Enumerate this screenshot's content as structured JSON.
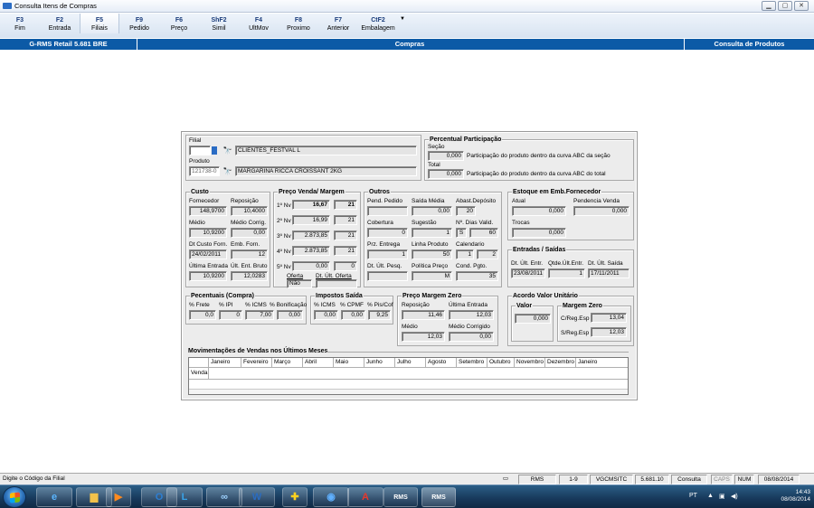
{
  "window": {
    "title": "Consulta Itens de Compras"
  },
  "fkeys": [
    {
      "key": "F3",
      "label": "Fim"
    },
    {
      "key": "F2",
      "label": "Entrada"
    },
    {
      "key": "F5",
      "label": "Filiais"
    },
    {
      "key": "F9",
      "label": "Pedido"
    },
    {
      "key": "F6",
      "label": "Preço"
    },
    {
      "key": "ShF2",
      "label": "Simil"
    },
    {
      "key": "F4",
      "label": "UltMov"
    },
    {
      "key": "F8",
      "label": "Proximo"
    },
    {
      "key": "F7",
      "label": "Anterior"
    },
    {
      "key": "CtF2",
      "label": "Embalagem"
    }
  ],
  "bluebar": {
    "left": "G-RMS Retail 5.681 BRE",
    "center": "Compras",
    "right": "Consulta de Produtos"
  },
  "filial": {
    "label": "Filial",
    "code": "",
    "name": "CLIENTES_FESTVAL L"
  },
  "produto": {
    "label": "Produto",
    "code": "121738-0",
    "name": "MARGARINA RICCA CROISSANT 2KG"
  },
  "percentual": {
    "title": "Percentual Participação",
    "secao_label": "Seção",
    "secao_value": "0,000",
    "secao_text": "Participação do produto dentro da curva ABC da seção",
    "total_label": "Total",
    "total_value": "0,000",
    "total_text": "Participação do produto dentro da curva ABC do total"
  },
  "custo": {
    "title": "Custo",
    "fornecedor_label": "Fornecedor",
    "fornecedor": "148,9700",
    "reposicao_label": "Reposição",
    "reposicao": "10,4000",
    "medio_label": "Médio",
    "medio": "10,9200",
    "medio_corrig_label": "Médio Corrig.",
    "medio_corrig": "0,00",
    "dt_custo_label": "Dt Custo Forn.",
    "dt_custo": "24/02/2011",
    "emb_forn_label": "Emb. Forn.",
    "emb_forn": "12",
    "ult_entrada_label": "Última Entrada",
    "ult_entrada": "10,9200",
    "ult_ent_bruto_label": "Últ. Ent. Bruto",
    "ult_ent_bruto": "12,0283"
  },
  "preco_venda": {
    "title": "Preço Venda/ Margem",
    "levels": [
      {
        "label": "1º Nv",
        "price": "16,67",
        "margin": "21"
      },
      {
        "label": "2º Nv",
        "price": "16,99",
        "margin": "21"
      },
      {
        "label": "3º Nv",
        "price": "2.873,85",
        "margin": "21"
      },
      {
        "label": "4º Nv",
        "price": "2.873,85",
        "margin": "21"
      },
      {
        "label": "5º Nv",
        "price": "0,00",
        "margin": "0"
      }
    ],
    "oferta_label": "Oferta",
    "oferta": "Não",
    "dt_ult_oferta_label": "Dt. Últ. Oferta",
    "dt_ult_oferta": ""
  },
  "outros": {
    "title": "Outros",
    "pend_pedido_label": "Pend. Pedido",
    "pend_pedido": "",
    "saida_media_label": "Saída Média",
    "saida_media": "0,00",
    "abast_label": "Abast.Depósito",
    "abast": "20",
    "cobertura_label": "Cobertura",
    "cobertura": "0",
    "sugestao_label": "Sugestão",
    "sugestao": "1",
    "dias_valid_label": "Nº. Dias Valid.",
    "dias_valid_flag": "S",
    "dias_valid": "60",
    "prz_entrega_label": "Prz. Entrega",
    "prz_entrega": "1",
    "linha_produto_label": "Linha Produto",
    "linha_produto": "50",
    "calendario_label": "Calendario",
    "calendario_a": "1",
    "calendario_b": "2",
    "dt_ult_pesq_label": "Dt. Últ. Pesq.",
    "dt_ult_pesq": "",
    "politica_label": "Política Preço",
    "politica": "M",
    "cond_pgto_label": "Cond. Pgto.",
    "cond_pgto": "35"
  },
  "estoque": {
    "title": "Estoque em Emb.Fornecedor",
    "atual_label": "Atual",
    "atual": "0,000",
    "pend_venda_label": "Pendencia Venda",
    "pend_venda": "0,000",
    "trocas_label": "Trocas",
    "trocas": "0,000"
  },
  "entradas_saidas": {
    "title": "Entradas / Saídas",
    "dt_ult_entr_label": "Dt. Últ. Entr.",
    "dt_ult_entr": "23/08/2011",
    "qtde_ult_entr_label": "Qtde.Últ.Entr.",
    "qtde_ult_entr": "1",
    "dt_ult_saida_label": "Dt. Últ. Saída",
    "dt_ult_saida": "17/11/2011"
  },
  "pct_compra": {
    "title": "Pecentuais (Compra)",
    "frete_label": "% Frete",
    "frete": "0,0",
    "ipi_label": "% IPI",
    "ipi": "0",
    "icms_label": "% ICMS",
    "icms": "7,00",
    "bonif_label": "% Bonificação",
    "bonif": "0,00"
  },
  "impostos": {
    "title": "Impostos Saída",
    "icms_label": "% ICMS",
    "icms": "0,00",
    "cpmf_label": "% CPMF",
    "cpmf": "0,00",
    "pis_label": "% Pis/Cof",
    "pis": "9,25"
  },
  "preco_margem_zero": {
    "title": "Preço Margem Zero",
    "reposicao_label": "Reposição",
    "reposicao": "11,46",
    "ult_entrada_label": "Última Entrada",
    "ult_entrada": "12,03",
    "medio_label": "Médio",
    "medio": "12,03",
    "medio_corrig_label": "Médio Corrigido",
    "medio_corrig": "0,00"
  },
  "acordo": {
    "title": "Acordo Valor Unitário",
    "valor_title": "Valor",
    "valor": "0,000",
    "margem_title": "Margem Zero",
    "creg_label": "C/Reg.Esp",
    "creg": "13,04",
    "sreg_label": "S/Reg.Esp",
    "sreg": "12,03"
  },
  "movimentacoes": {
    "title": "Movimentações de Vendas nos Últimos Meses",
    "months": [
      "Janeiro",
      "Fevereiro",
      "Março",
      "Abril",
      "Maio",
      "Junho",
      "Julho",
      "Agosto",
      "Setembro",
      "Outubro",
      "Novembro",
      "Dezembro",
      "Janeiro"
    ],
    "row_label": "Venda"
  },
  "status": {
    "message": "Digite o Código da Filial",
    "panels": [
      "RMS",
      "1-9",
      "VGCMSITC",
      "5.681.10",
      "Consulta",
      "CAPS",
      "NUM",
      "08/08/2014"
    ]
  },
  "taskbar": {
    "lang": "PT",
    "time": "14:43",
    "date": "08/08/2014",
    "rms1": "RMS",
    "rms2": "RMS"
  }
}
